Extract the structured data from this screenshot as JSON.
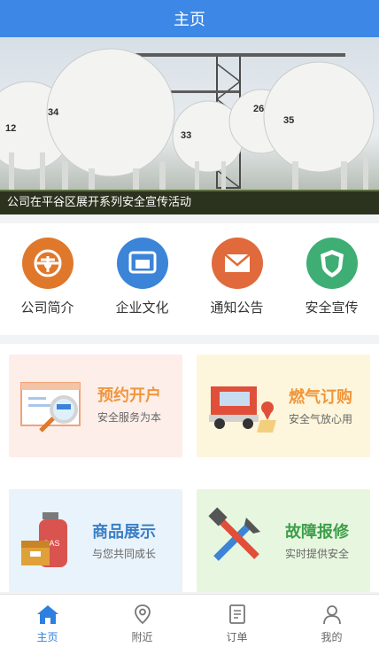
{
  "header": {
    "title": "主页"
  },
  "banner": {
    "caption": "公司在平谷区展开系列安全宣传活动",
    "tank_numbers": [
      "12",
      "34",
      "33",
      "26",
      "35"
    ]
  },
  "quick_links": [
    {
      "label": "公司简介",
      "icon": "company-icon",
      "color": "#e0782b"
    },
    {
      "label": "企业文化",
      "icon": "culture-icon",
      "color": "#3c84d8"
    },
    {
      "label": "通知公告",
      "icon": "envelope-icon",
      "color": "#e06a3c"
    },
    {
      "label": "安全宣传",
      "icon": "shield-icon",
      "color": "#3fae74"
    }
  ],
  "cards": [
    {
      "title": "预约开户",
      "subtitle": "安全服务为本",
      "title_color": "#f0963c",
      "bg": "#fdeee9"
    },
    {
      "title": "燃气订购",
      "subtitle": "安全气放心用",
      "title_color": "#f0963c",
      "bg": "#fdf6dc"
    },
    {
      "title": "商品展示",
      "subtitle": "与您共同成长",
      "title_color": "#3a7fc6",
      "bg": "#e9f3fb"
    },
    {
      "title": "故障报修",
      "subtitle": "实时提供安全",
      "title_color": "#3d9f4a",
      "bg": "#e7f7df"
    }
  ],
  "tabs": [
    {
      "label": "主页",
      "icon": "home-icon",
      "active": true
    },
    {
      "label": "附近",
      "icon": "location-pin-icon",
      "active": false
    },
    {
      "label": "订单",
      "icon": "order-document-icon",
      "active": false
    },
    {
      "label": "我的",
      "icon": "user-icon",
      "active": false
    }
  ],
  "colors": {
    "header": "#3d88e6",
    "tab_active": "#2f7fe0"
  }
}
